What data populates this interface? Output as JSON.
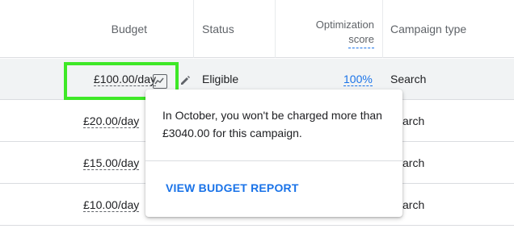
{
  "header": {
    "budget": "Budget",
    "status": "Status",
    "optimization_line1": "Optimization",
    "optimization_line2": "score",
    "campaign_type": "Campaign type"
  },
  "rows": [
    {
      "budget": "£100.00/day",
      "status": "Eligible",
      "optimization": "100%",
      "type": "Search"
    },
    {
      "budget": "£20.00/day",
      "type": "arch"
    },
    {
      "budget": "£15.00/day",
      "type": "arch"
    },
    {
      "budget": "£10.00/day",
      "type": "arch"
    }
  ],
  "popup": {
    "text": "In October, you won't be charged more than £3040.00 for this campaign.",
    "link": "VIEW BUDGET REPORT"
  },
  "colors": {
    "accent": "#1a73e8",
    "highlight": "#3ee827",
    "row_selected": "#f1f3f4"
  }
}
